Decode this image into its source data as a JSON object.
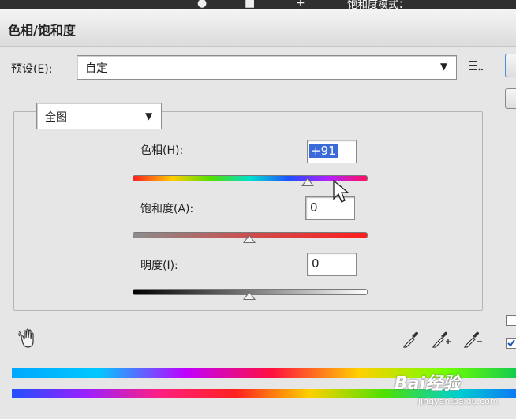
{
  "app": {
    "topbar_mode_label": "饱和度模式：",
    "title": "色相/饱和度"
  },
  "preset": {
    "label": "预设(E):",
    "value": "自定"
  },
  "channel": {
    "value": "全图"
  },
  "hue": {
    "label": "色相(H):",
    "value": "+91",
    "position": 0.75
  },
  "saturation": {
    "label": "饱和度(A):",
    "value": "0",
    "position": 0.5
  },
  "lightness": {
    "label": "明度(I):",
    "value": "0",
    "position": 0.5
  },
  "icons": {
    "menu": "list-menu-icon",
    "hand": "hand-adjust-icon",
    "eyedroppers": [
      "eyedropper-icon",
      "eyedropper-plus-icon",
      "eyedropper-minus-icon"
    ]
  },
  "watermark": {
    "line1": "Bai经验",
    "line2": "jingyan.baidu.com"
  }
}
